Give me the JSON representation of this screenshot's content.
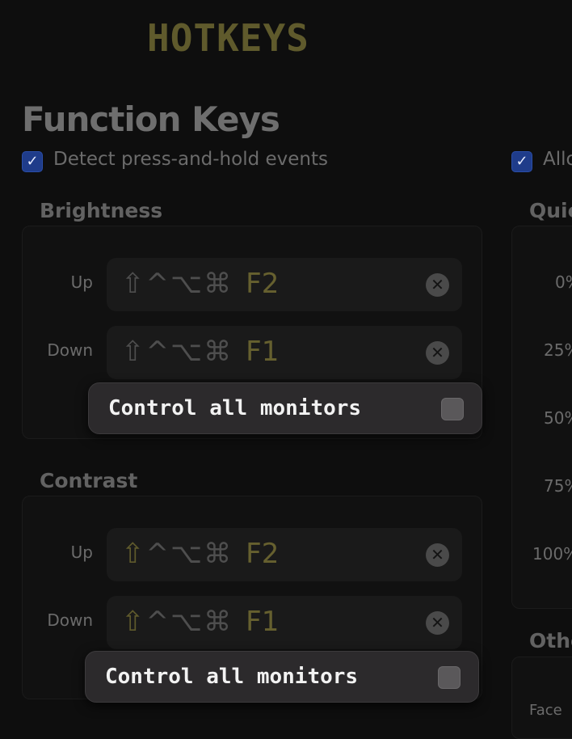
{
  "header": {
    "title": "HOTKEYS"
  },
  "section": {
    "title": "Function Keys",
    "detect_label": "Detect press-and-hold events",
    "right_label": "Allo"
  },
  "brightness": {
    "title": "Brightness",
    "rows": [
      {
        "label": "Up",
        "modifiers": "⇧^⌥⌘",
        "key": "F2"
      },
      {
        "label": "Down",
        "modifiers": "⇧^⌥⌘",
        "key": "F1"
      }
    ],
    "popup_label": "Control all monitors"
  },
  "contrast": {
    "title": "Contrast",
    "rows": [
      {
        "label": "Up",
        "shift": "⇧",
        "modifiers": "^⌥⌘",
        "key": "F2"
      },
      {
        "label": "Down",
        "shift": "⇧",
        "modifiers": "^⌥⌘",
        "key": "F1"
      }
    ],
    "popup_label": "Control all monitors"
  },
  "quick": {
    "title": "Quic",
    "levels": [
      "0%",
      "25%",
      "50%",
      "75%",
      "100%"
    ]
  },
  "other": {
    "title": "Othe",
    "first_label": "Face"
  },
  "colors": {
    "accent": "#5f5a2c",
    "checkbox": "#1f3c8a"
  }
}
